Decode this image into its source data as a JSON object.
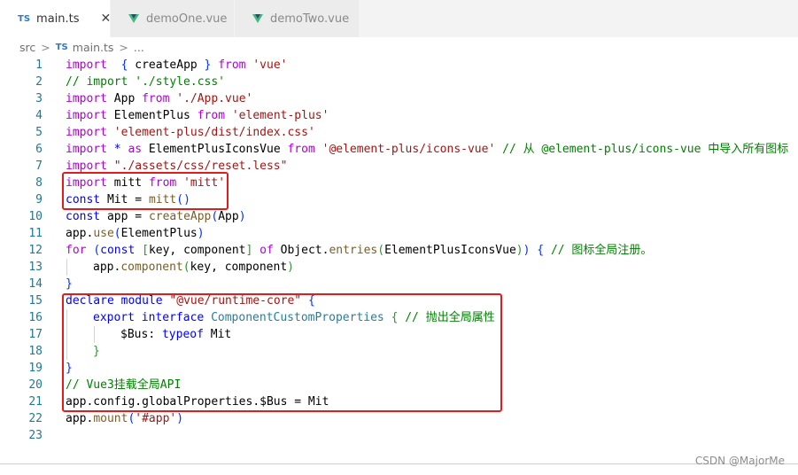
{
  "tabs": [
    {
      "label": "main.ts",
      "badge": "TS",
      "close": "✕",
      "active": true
    },
    {
      "label": "demoOne.vue",
      "active": false
    },
    {
      "label": "demoTwo.vue",
      "active": false
    }
  ],
  "breadcrumb": {
    "folder": "src",
    "sep": ">",
    "badge": "TS",
    "file": "main.ts",
    "more": "..."
  },
  "colors": {
    "highlight": "#e11c1c",
    "line_number": "#237893"
  },
  "code_lines": [
    {
      "n": "1",
      "tokens": [
        [
          "kw2",
          "import"
        ],
        [
          "",
          "  "
        ],
        [
          "br1",
          "{"
        ],
        [
          "",
          " createApp "
        ],
        [
          "br1",
          "}"
        ],
        [
          "",
          " "
        ],
        [
          "kw2",
          "from"
        ],
        [
          "",
          " "
        ],
        [
          "str",
          "'vue'"
        ]
      ]
    },
    {
      "n": "2",
      "tokens": [
        [
          "cm",
          "// import './style.css'"
        ]
      ]
    },
    {
      "n": "3",
      "tokens": [
        [
          "kw2",
          "import"
        ],
        [
          "",
          " App "
        ],
        [
          "kw2",
          "from"
        ],
        [
          "",
          " "
        ],
        [
          "str",
          "'./App.vue'"
        ]
      ]
    },
    {
      "n": "4",
      "tokens": [
        [
          "kw2",
          "import"
        ],
        [
          "",
          " ElementPlus "
        ],
        [
          "kw2",
          "from"
        ],
        [
          "",
          " "
        ],
        [
          "str",
          "'element-plus'"
        ]
      ]
    },
    {
      "n": "5",
      "tokens": [
        [
          "kw2",
          "import"
        ],
        [
          "",
          " "
        ],
        [
          "str",
          "'element-plus/dist/index.css'"
        ]
      ]
    },
    {
      "n": "6",
      "tokens": [
        [
          "kw2",
          "import"
        ],
        [
          "",
          " "
        ],
        [
          "kw",
          "*"
        ],
        [
          "",
          " "
        ],
        [
          "kw2",
          "as"
        ],
        [
          "",
          " ElementPlusIconsVue "
        ],
        [
          "kw2",
          "from"
        ],
        [
          "",
          " "
        ],
        [
          "str",
          "'@element-plus/icons-vue'"
        ],
        [
          "",
          " "
        ],
        [
          "cm",
          "// 从 @element-plus/icons-vue 中导入所有图标"
        ]
      ]
    },
    {
      "n": "7",
      "tokens": [
        [
          "kw2",
          "import"
        ],
        [
          "",
          " "
        ],
        [
          "str",
          "\"./assets/css/reset.less\""
        ]
      ]
    },
    {
      "n": "8",
      "tokens": [
        [
          "kw2",
          "import"
        ],
        [
          "",
          " mitt "
        ],
        [
          "kw2",
          "from"
        ],
        [
          "",
          " "
        ],
        [
          "str",
          "'mitt'"
        ]
      ]
    },
    {
      "n": "9",
      "tokens": [
        [
          "kw",
          "const"
        ],
        [
          "",
          " Mit = "
        ],
        [
          "fn",
          "mitt"
        ],
        [
          "br1",
          "()"
        ]
      ]
    },
    {
      "n": "10",
      "tokens": [
        [
          "kw",
          "const"
        ],
        [
          "",
          " app = "
        ],
        [
          "fn",
          "createApp"
        ],
        [
          "br1",
          "("
        ],
        [
          "",
          "App"
        ],
        [
          "br1",
          ")"
        ]
      ]
    },
    {
      "n": "11",
      "tokens": [
        [
          "",
          "app."
        ],
        [
          "fn",
          "use"
        ],
        [
          "br1",
          "("
        ],
        [
          "",
          "ElementPlus"
        ],
        [
          "br1",
          ")"
        ]
      ]
    },
    {
      "n": "12",
      "tokens": [
        [
          "kw2",
          "for"
        ],
        [
          "",
          " "
        ],
        [
          "br1",
          "("
        ],
        [
          "kw",
          "const"
        ],
        [
          "",
          " "
        ],
        [
          "br2",
          "["
        ],
        [
          "",
          "key, component"
        ],
        [
          "br2",
          "]"
        ],
        [
          "",
          " "
        ],
        [
          "kw2",
          "of"
        ],
        [
          "",
          " Object."
        ],
        [
          "fn",
          "entries"
        ],
        [
          "br2",
          "("
        ],
        [
          "",
          "ElementPlusIconsVue"
        ],
        [
          "br2",
          ")"
        ],
        [
          "br1",
          ")"
        ],
        [
          "",
          " "
        ],
        [
          "br1",
          "{"
        ],
        [
          "",
          " "
        ],
        [
          "cm",
          "// 图标全局注册。"
        ]
      ]
    },
    {
      "n": "13",
      "indent": 1,
      "tokens": [
        [
          "",
          "app."
        ],
        [
          "fn",
          "component"
        ],
        [
          "br2",
          "("
        ],
        [
          "",
          "key, component"
        ],
        [
          "br2",
          ")"
        ]
      ]
    },
    {
      "n": "14",
      "tokens": [
        [
          "br1",
          "}"
        ]
      ]
    },
    {
      "n": "15",
      "tokens": [
        [
          "kw",
          "declare"
        ],
        [
          "",
          " "
        ],
        [
          "kw",
          "module"
        ],
        [
          "",
          " "
        ],
        [
          "str",
          "\"@vue/runtime-core\""
        ],
        [
          "",
          " "
        ],
        [
          "br1",
          "{"
        ]
      ]
    },
    {
      "n": "16",
      "indent": 1,
      "tokens": [
        [
          "kw",
          "export"
        ],
        [
          "",
          " "
        ],
        [
          "kw",
          "interface"
        ],
        [
          "",
          " "
        ],
        [
          "ty",
          "ComponentCustomProperties"
        ],
        [
          "",
          " "
        ],
        [
          "br2",
          "{"
        ],
        [
          "",
          " "
        ],
        [
          "cm",
          "// 抛出全局属性"
        ]
      ]
    },
    {
      "n": "17",
      "indent": 2,
      "tokens": [
        [
          "",
          "$Bus"
        ],
        [
          "",
          ": "
        ],
        [
          "kw",
          "typeof"
        ],
        [
          "",
          " Mit"
        ]
      ]
    },
    {
      "n": "18",
      "indent": 1,
      "tokens": [
        [
          "br2",
          "}"
        ]
      ]
    },
    {
      "n": "19",
      "tokens": [
        [
          "br1",
          "}"
        ]
      ]
    },
    {
      "n": "20",
      "tokens": [
        [
          "cm",
          "// Vue3挂载全局API"
        ]
      ]
    },
    {
      "n": "21",
      "tokens": [
        [
          "",
          "app.config.globalProperties.$Bus = Mit"
        ]
      ]
    },
    {
      "n": "22",
      "tokens": [
        [
          "",
          "app."
        ],
        [
          "fn",
          "mount"
        ],
        [
          "br1",
          "("
        ],
        [
          "str",
          "'#app'"
        ],
        [
          "br1",
          ")"
        ]
      ]
    },
    {
      "n": "23",
      "tokens": []
    }
  ],
  "watermark": "CSDN @MajorMe"
}
